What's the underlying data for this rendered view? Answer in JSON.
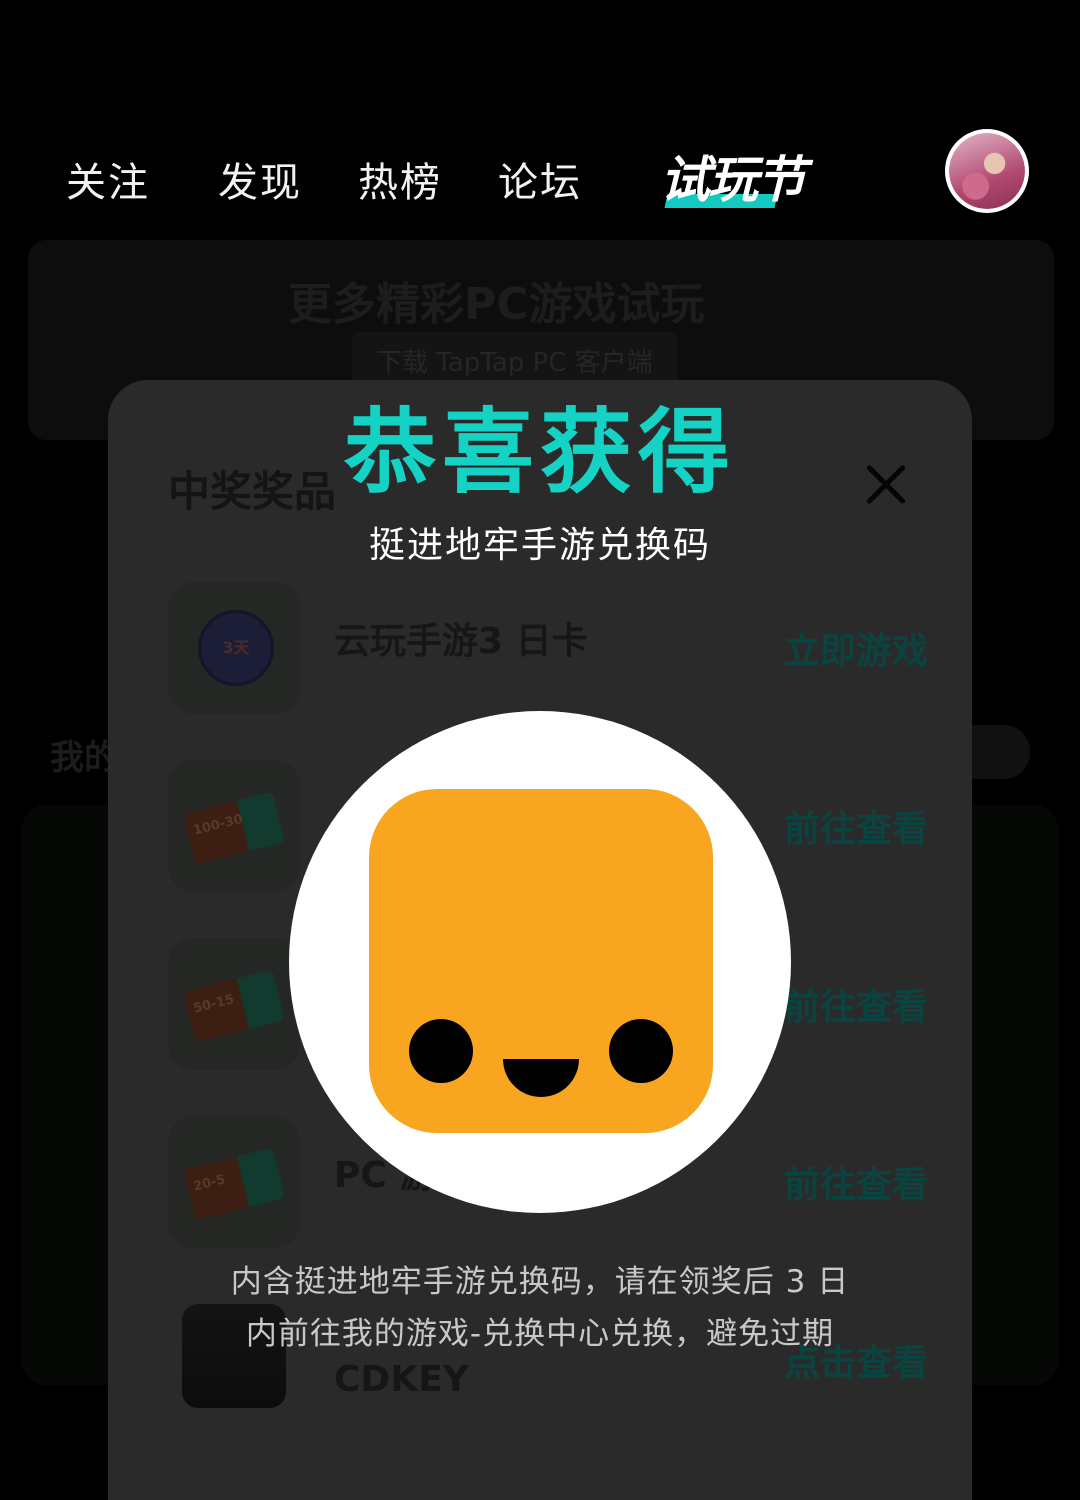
{
  "nav": {
    "tabs": [
      "关注",
      "发现",
      "热榜",
      "论坛"
    ],
    "festival_label": "试玩节",
    "accent_color": "#14c9c0"
  },
  "background": {
    "banner_title": "更多精彩PC游戏试玩",
    "banner_button": "下载 TapTap PC 客户端",
    "left_label": "我的"
  },
  "sheet": {
    "title": "中奖奖品",
    "rows": [
      {
        "icon": "cloud-play-badge-icon",
        "icon_text": "3天",
        "name": "云玩手游3 日卡",
        "action": "立即游戏"
      },
      {
        "icon": "coupon-icon",
        "icon_text": "100-30",
        "name": "",
        "action": "前往查看"
      },
      {
        "icon": "coupon-icon",
        "icon_text": "50-15",
        "name": "",
        "action": "前往查看"
      },
      {
        "icon": "coupon-icon",
        "icon_text": "20-5",
        "name": "PC 游",
        "action": "前往查看"
      },
      {
        "icon": "game-thumbnail-icon",
        "icon_text": "",
        "name": "CDKEY",
        "action": "点击查看"
      }
    ]
  },
  "popup": {
    "title": "恭喜获得",
    "subtitle": "挺进地牢手游兑换码",
    "icon": "smiley-app-icon",
    "icon_color": "#f8a51f",
    "notice_line1": "内含挺进地牢手游兑换码，请在领奖后 3 日",
    "notice_line2": "内前往我的游戏-兑换中心兑换，避免过期"
  }
}
